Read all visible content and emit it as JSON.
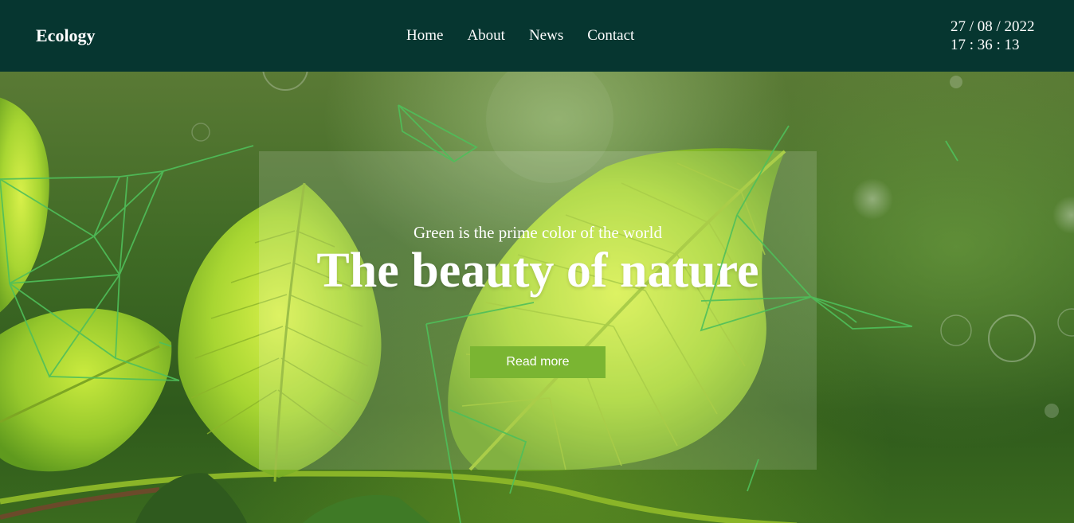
{
  "header": {
    "logo": "Ecology",
    "nav": [
      "Home",
      "About",
      "News",
      "Contact"
    ],
    "date": "27 / 08 / 2022",
    "time": "17 : 36 : 13"
  },
  "hero": {
    "subtitle": "Green is the prime color of the world",
    "headline": "The beauty of nature",
    "button_label": "Read more",
    "background_image": "leaves-icon"
  },
  "colors": {
    "header_bg": "#063630",
    "button_bg": "#7ab532",
    "network_lines": "#4fbf5a"
  }
}
